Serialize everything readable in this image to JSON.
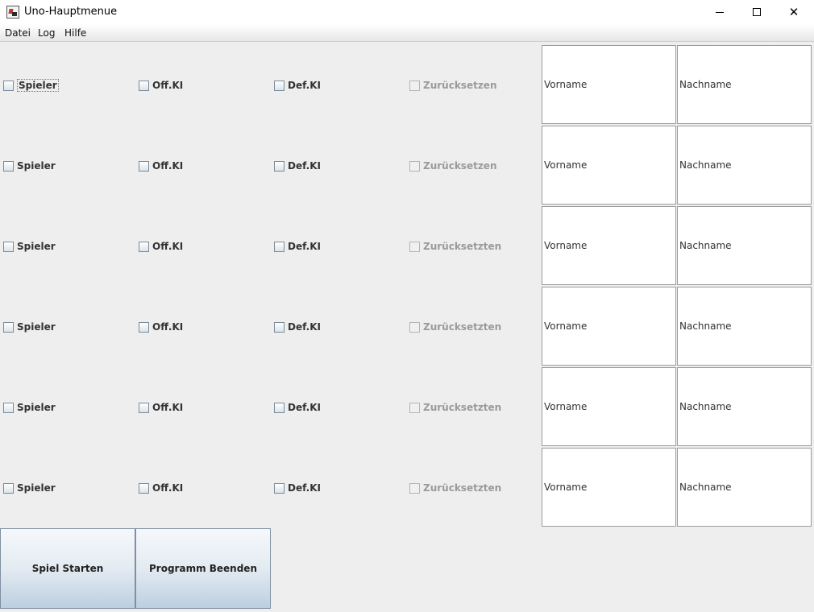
{
  "window": {
    "title": "Uno-Hauptmenue",
    "minimize": "—",
    "maximize": "☐",
    "close": "✕"
  },
  "menu": [
    "Datei",
    "Log",
    "Hilfe"
  ],
  "rows": [
    {
      "spieler": "Spieler",
      "offki": "Off.KI",
      "defki": "Def.KI",
      "reset": "Zurücksetzen",
      "vorname": "Vorname",
      "nachname": "Nachname"
    },
    {
      "spieler": "Spieler",
      "offki": "Off.KI",
      "defki": "Def.KI",
      "reset": "Zurücksetzen",
      "vorname": "Vorname",
      "nachname": "Nachname"
    },
    {
      "spieler": "Spieler",
      "offki": "Off.KI",
      "defki": "Def.KI",
      "reset": "Zurücksetzten",
      "vorname": "Vorname",
      "nachname": "Nachname"
    },
    {
      "spieler": "Spieler",
      "offki": "Off.KI",
      "defki": "Def.KI",
      "reset": "Zurücksetzten",
      "vorname": "Vorname",
      "nachname": "Nachname"
    },
    {
      "spieler": "Spieler",
      "offki": "Off.KI",
      "defki": "Def.KI",
      "reset": "Zurücksetzten",
      "vorname": "Vorname",
      "nachname": "Nachname"
    },
    {
      "spieler": "Spieler",
      "offki": "Off.KI",
      "defki": "Def.KI",
      "reset": "Zurücksetzten",
      "vorname": "Vorname",
      "nachname": "Nachname"
    }
  ],
  "buttons": {
    "start": "Spiel Starten",
    "quit": "Programm Beenden"
  }
}
